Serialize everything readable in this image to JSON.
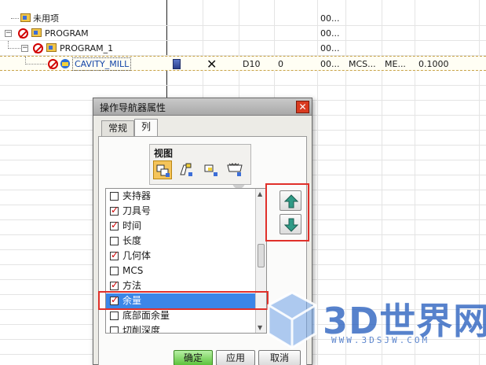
{
  "tree": {
    "rows": [
      {
        "name": "未用项",
        "cols": [
          "00..."
        ]
      },
      {
        "name": "PROGRAM",
        "cols": [
          "00..."
        ]
      },
      {
        "name": "PROGRAM_1",
        "cols": [
          "00..."
        ]
      },
      {
        "name": "CAVITY_MILL",
        "cols": [
          "D10",
          "0",
          "00...",
          "MCS...",
          "ME...",
          "0.1000"
        ]
      }
    ]
  },
  "dialog": {
    "title": "操作导航器属性",
    "tabs": [
      "常规",
      "列"
    ],
    "view_label": "视图",
    "view_buttons": [
      "program-order-view-icon",
      "machine-tool-view-icon",
      "geometry-view-icon",
      "method-view-icon"
    ],
    "columns": [
      {
        "label": "夹持器",
        "checked": false
      },
      {
        "label": "刀具号",
        "checked": true
      },
      {
        "label": "时间",
        "checked": true
      },
      {
        "label": "长度",
        "checked": false
      },
      {
        "label": "几何体",
        "checked": true
      },
      {
        "label": "MCS",
        "checked": false
      },
      {
        "label": "方法",
        "checked": true
      },
      {
        "label": "余量",
        "checked": true,
        "selected": true
      },
      {
        "label": "底部面余量",
        "checked": false
      },
      {
        "label": "切削深度",
        "checked": false
      }
    ],
    "buttons": {
      "ok": "确定",
      "apply": "应用",
      "cancel": "取消"
    },
    "colors": {
      "selection": "#3b86e8",
      "highlight_frame": "#e0302a",
      "ok_button": "#5cc23a"
    }
  },
  "watermark": {
    "text": "3D世界网",
    "url": "WWW.3DSJW.COM"
  }
}
